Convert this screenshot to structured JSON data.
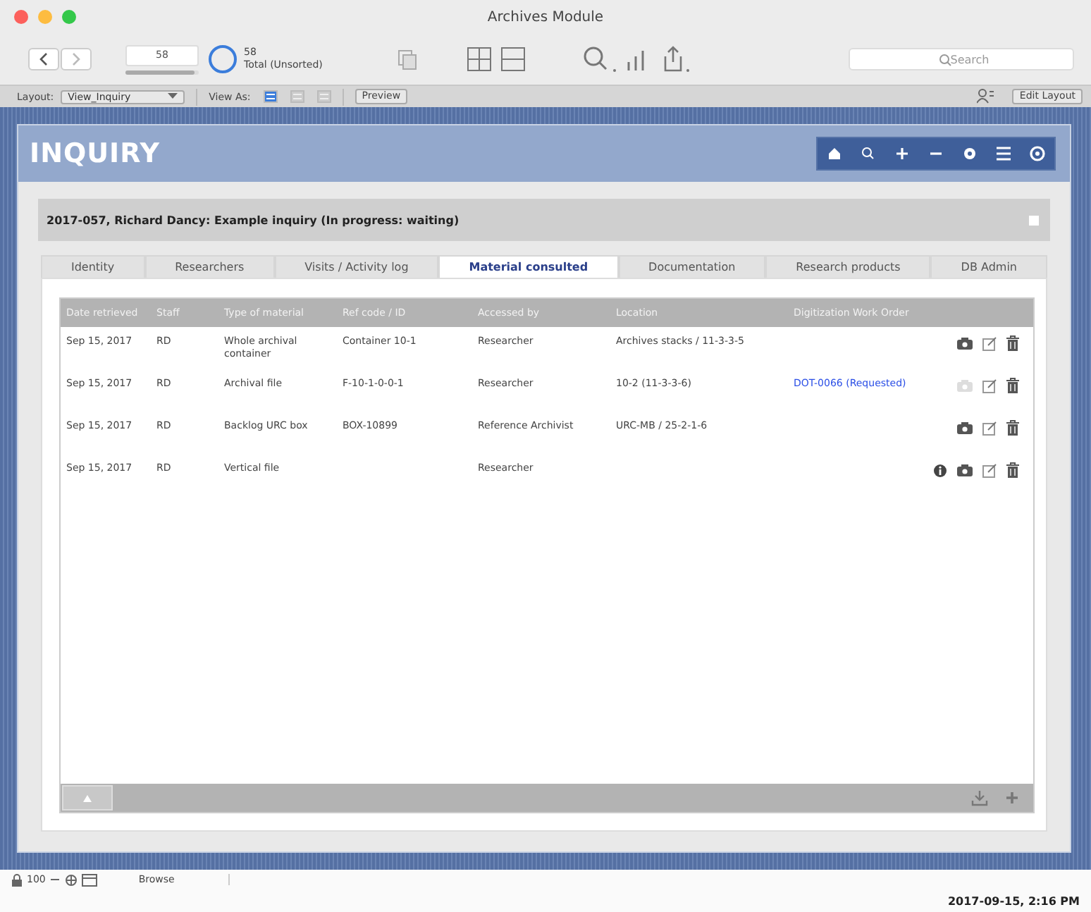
{
  "window": {
    "title": "Archives Module"
  },
  "toolbar": {
    "record_number": "58",
    "found_count": "58",
    "found_label": "Total (Unsorted)",
    "record_slider": {
      "level": 0.95
    },
    "search": {
      "placeholder": "Search"
    }
  },
  "layout_bar": {
    "layout_label": "Layout:",
    "layout_value": "View_Inquiry",
    "view_as_label": "View As:",
    "view_modes": [
      {
        "selected": true
      },
      {
        "selected": false
      },
      {
        "selected": false
      }
    ],
    "preview_button": "Preview",
    "edit_layout_button": "Edit Layout"
  },
  "header": {
    "title": "INQUIRY"
  },
  "record_title": "2017-057, Richard Dancy: Example inquiry (In progress: waiting)",
  "record_checked": false,
  "tabs": [
    {
      "label": "Identity",
      "selected": false
    },
    {
      "label": "Researchers",
      "selected": false
    },
    {
      "label": "Visits / Activity log",
      "selected": false
    },
    {
      "label": "Material consulted",
      "selected": true
    },
    {
      "label": "Documentation",
      "selected": false
    },
    {
      "label": "Research products",
      "selected": false
    },
    {
      "label": "DB Admin",
      "selected": false
    }
  ],
  "table": {
    "columns": [
      "Date retrieved",
      "Staff",
      "Type of material",
      "Ref code / ID",
      "Accessed by",
      "Location",
      "Digitization Work Order"
    ],
    "rows": [
      {
        "cells": [
          "Sep 15, 2017",
          "RD",
          "Whole archival container",
          "Container 10-1",
          "Researcher",
          "Archives stacks / 11-3-3-5",
          ""
        ],
        "info": false,
        "camera_enabled": true
      },
      {
        "cells": [
          "Sep 15, 2017",
          "RD",
          "Archival file",
          "F-10-1-0-0-1",
          "Researcher",
          "10-2 (11-3-3-6)",
          "DOT-0066 (Requested)"
        ],
        "info": false,
        "camera_enabled": false
      },
      {
        "cells": [
          "Sep 15, 2017",
          "RD",
          "Backlog URC box",
          "BOX-10899",
          "Reference Archivist",
          "URC-MB / 25-2-1-6",
          ""
        ],
        "info": false,
        "camera_enabled": true
      },
      {
        "cells": [
          "Sep 15, 2017",
          "RD",
          "Vertical file",
          "",
          "Researcher",
          "",
          ""
        ],
        "info": true,
        "camera_enabled": true
      }
    ]
  },
  "status_bar": {
    "zoom": "100",
    "mode": "Browse",
    "timestamp": "2017-09-15, 2:16 PM"
  }
}
